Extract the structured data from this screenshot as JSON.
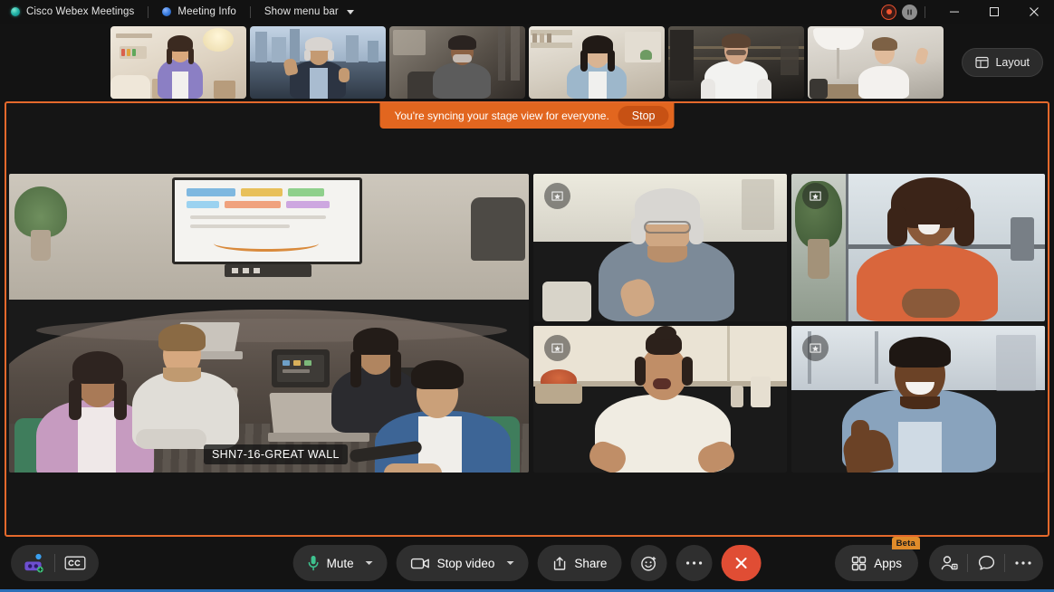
{
  "titlebar": {
    "app_name": "Cisco Webex Meetings",
    "meeting_info": "Meeting Info",
    "menu_toggle": "Show menu bar",
    "record_icon": "record-icon",
    "pause_icon": "pause-recording-icon",
    "minimize_icon": "minimize-icon",
    "maximize_icon": "maximize-icon",
    "close_icon": "close-icon"
  },
  "filmstrip": {
    "layout_label": "Layout",
    "layout_icon": "layout-grid-icon",
    "thumbnails": [
      {
        "name": "participant-thumb-1",
        "skin": "#d9a87c",
        "hair": "#3b2a20",
        "shirt": "#8b7fc4",
        "bg1": "#e8e0d4",
        "bg2": "#cfc2b1"
      },
      {
        "name": "participant-thumb-2",
        "skin": "#c49a72",
        "hair": "#d8d4d0",
        "shirt": "#7f94ad",
        "bg1": "#aebfd2",
        "bg2": "#5d6b7d"
      },
      {
        "name": "participant-thumb-3",
        "skin": "#8c6244",
        "hair": "#2a2320",
        "shirt": "#5c5c5c",
        "bg1": "#6e6862",
        "bg2": "#3a3633"
      },
      {
        "name": "participant-thumb-4",
        "skin": "#d9b493",
        "hair": "#211a16",
        "shirt": "#9db7cb",
        "bg1": "#ddd8cf",
        "bg2": "#b3ab9e"
      },
      {
        "name": "participant-thumb-5",
        "skin": "#d2a586",
        "hair": "#5b4332",
        "shirt": "#f2f2f0",
        "bg1": "#4a463f",
        "bg2": "#1e1c19"
      },
      {
        "name": "participant-thumb-6",
        "skin": "#e0bb9b",
        "hair": "#7d6145",
        "shirt": "#f3f1ee",
        "bg1": "#d8d5cf",
        "bg2": "#a6a29a"
      }
    ]
  },
  "stage": {
    "sync_banner_text": "You're syncing your stage view for everyone.",
    "stop_label": "Stop",
    "room_label": "SHN7-16-GREAT WALL",
    "pin_icon": "stage-pin-icon",
    "tiles": [
      {
        "name": "stage-tile-conference-room",
        "pinned": false
      },
      {
        "name": "stage-tile-participant-1",
        "pinned": true
      },
      {
        "name": "stage-tile-participant-2",
        "pinned": true
      },
      {
        "name": "stage-tile-participant-3",
        "pinned": true
      },
      {
        "name": "stage-tile-participant-4",
        "pinned": true
      }
    ]
  },
  "toolbar": {
    "ai_assistant_icon": "webex-ai-assistant-icon",
    "captions_icon": "closed-captions-icon",
    "mute_label": "Mute",
    "mute_icon": "microphone-icon",
    "stop_video_label": "Stop video",
    "video_icon": "video-camera-icon",
    "share_label": "Share",
    "share_icon": "share-screen-icon",
    "reactions_icon": "reactions-smiley-icon",
    "more_icon": "more-options-icon",
    "end_call_icon": "end-call-icon",
    "apps_label": "Apps",
    "apps_icon": "apps-grid-icon",
    "apps_badge": "Beta",
    "participants_icon": "participants-icon",
    "chat_icon": "chat-bubble-icon",
    "more_right_icon": "more-options-icon"
  },
  "colors": {
    "accent_orange": "#e4692c",
    "banner_orange": "#e2661f",
    "end_call_red": "#e04d34",
    "beta_badge": "#e08b2a",
    "mic_green": "#3ec28f",
    "bottom_accent": "#2b6fb8"
  }
}
